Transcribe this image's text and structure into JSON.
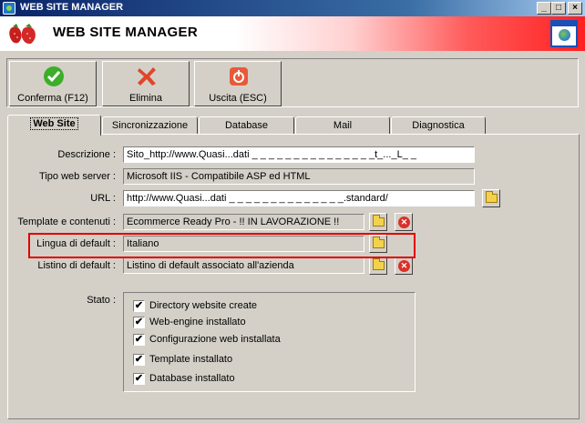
{
  "window": {
    "title": "WEB SITE MANAGER"
  },
  "header": {
    "title": "WEB SITE MANAGER"
  },
  "toolbar": {
    "confirm_label": "Conferma (F12)",
    "delete_label": "Elimina",
    "exit_label": "Uscita (ESC)"
  },
  "tabs": [
    {
      "label": "Web Site"
    },
    {
      "label": "Sincronizzazione"
    },
    {
      "label": "Database"
    },
    {
      "label": "Mail"
    },
    {
      "label": "Diagnostica"
    }
  ],
  "form": {
    "descrizione": {
      "label": "Descrizione :",
      "value": "Sito_http://www.Quasi...dati _ _ _ _ _ _ _ _ _ _ _ _ _ _ _t_..._L_ _"
    },
    "tipo_server": {
      "label": "Tipo web server :",
      "value": "Microsoft IIS - Compatibile ASP ed HTML"
    },
    "url": {
      "label": "URL :",
      "value": "http://www.Quasi...dati  _ _ _ _ _ _ _ _ _ _ _ _ _ _.standard/"
    },
    "template": {
      "label": "Template e contenuti :",
      "value": "Ecommerce Ready Pro - !! IN LAVORAZIONE !!"
    },
    "lingua": {
      "label": "Lingua di default :",
      "value": "Italiano"
    },
    "listino": {
      "label": "Listino di default :",
      "value": "Listino di default associato all'azienda"
    }
  },
  "stato": {
    "label": "Stato :",
    "items": [
      {
        "label": "Directory website create",
        "check": "✔"
      },
      {
        "label": "Web-engine installato",
        "check": "✔"
      },
      {
        "label": "Configurazione web installata",
        "check": "✔"
      },
      {
        "label": "Template installato",
        "check": "✔"
      },
      {
        "label": "Database installato",
        "check": "✔"
      }
    ]
  },
  "colors": {
    "accent_red": "#e00000",
    "title_blue": "#0a246a"
  }
}
